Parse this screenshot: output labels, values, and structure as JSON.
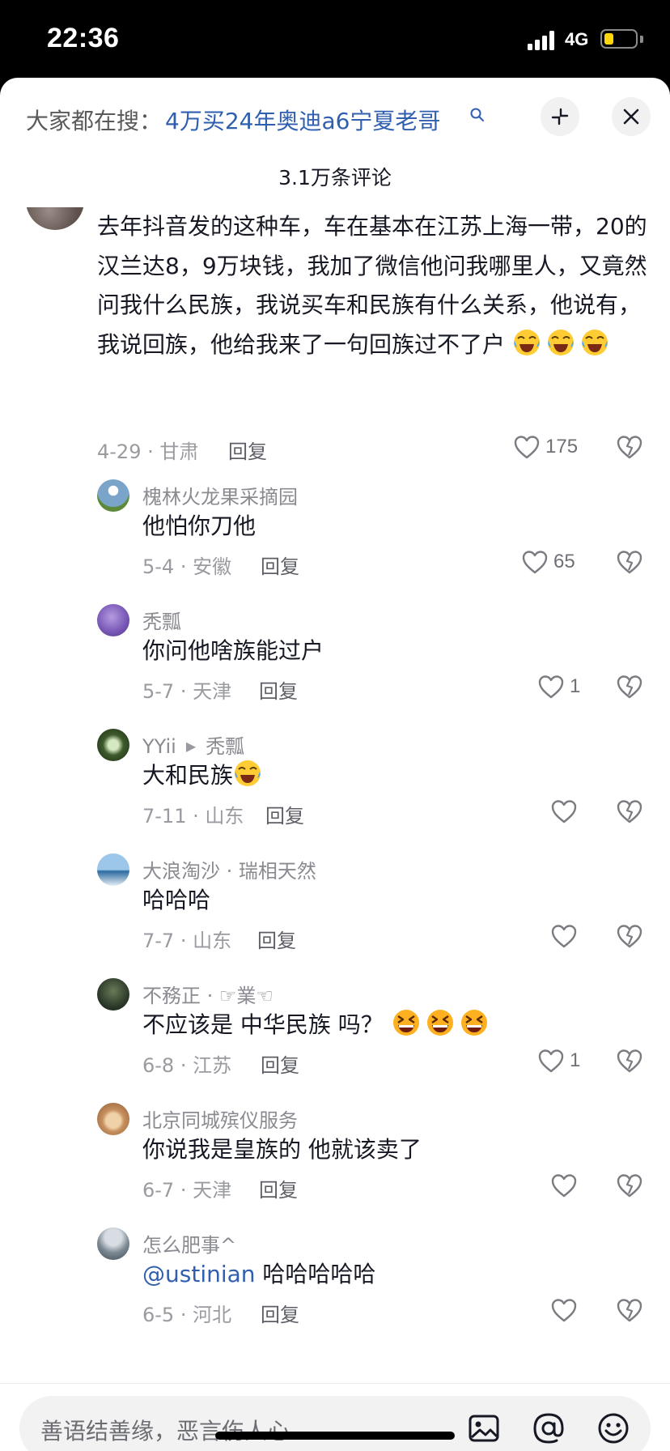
{
  "status_bar": {
    "time": "22:36",
    "network": "4G",
    "battery_level": 0.3
  },
  "search": {
    "prefix": "大家都在搜：",
    "query": "4万买24年奥迪a6宁夏老哥"
  },
  "comments_title": "3.1万条评论",
  "main_comment": {
    "text": "去年抖音发的这种车，车在基本在江苏上海一带，20的汉兰达8，9万块钱，我加了微信他问我哪里人，又竟然问我什么民族，我说买车和民族有什么关系，他说有，我说回族，他给我来了一句回族过不了户",
    "emojis": [
      "laugh-cry",
      "laugh-cry",
      "laugh-cry"
    ],
    "meta": "4-29 · 甘肃",
    "reply_label": "回复",
    "likes": "175"
  },
  "replies": [
    {
      "user": "槐林火龙果采摘园",
      "text": "他怕你刀他",
      "meta": "5-4 · 安徽",
      "reply_label": "回复",
      "likes": "65",
      "avatar_color": "#7ba4c9"
    },
    {
      "user": "秃瓢",
      "text": "你问他啥族能过户",
      "meta": "5-7 · 天津",
      "reply_label": "回复",
      "likes": "1",
      "avatar_color": "#7b5ab8"
    },
    {
      "user": "YYii",
      "reply_to": "秃瓢",
      "text": "大和民族",
      "emoji": "laugh-cry",
      "meta": "7-11 · 山东",
      "reply_label": "回复",
      "likes": "",
      "avatar_color": "#3d5a2c"
    },
    {
      "user": "大浪淘沙 · 瑞相天然",
      "text": "哈哈哈",
      "meta": "7-7 · 山东",
      "reply_label": "回复",
      "likes": "",
      "avatar_color": "#4a86b8"
    },
    {
      "user": "不務正 · ☞業☜",
      "text": "不应该是 中华民族 吗？",
      "emojis": [
        "grin-squint",
        "grin-squint",
        "grin-squint"
      ],
      "meta": "6-8 · 江苏",
      "reply_label": "回复",
      "likes": "1",
      "avatar_color": "#2d3b2a"
    },
    {
      "user": "北京同城殡仪服务",
      "text": "你说我是皇族的 他就该卖了",
      "meta": "6-7 · 天津",
      "reply_label": "回复",
      "likes": "",
      "avatar_color": "#c89060"
    },
    {
      "user": "怎么肥事^",
      "mention": "@ustinian",
      "text": " 哈哈哈哈哈",
      "meta": "6-5 · 河北",
      "reply_label": "回复",
      "likes": "",
      "avatar_color": "#7d8a94"
    }
  ],
  "input": {
    "placeholder": "善语结善缘，恶言伤人心"
  },
  "icons": [
    "search-icon",
    "expand-icon",
    "close-icon",
    "heart-icon",
    "dislike-icon",
    "image-icon",
    "at-icon",
    "emoji-icon"
  ]
}
